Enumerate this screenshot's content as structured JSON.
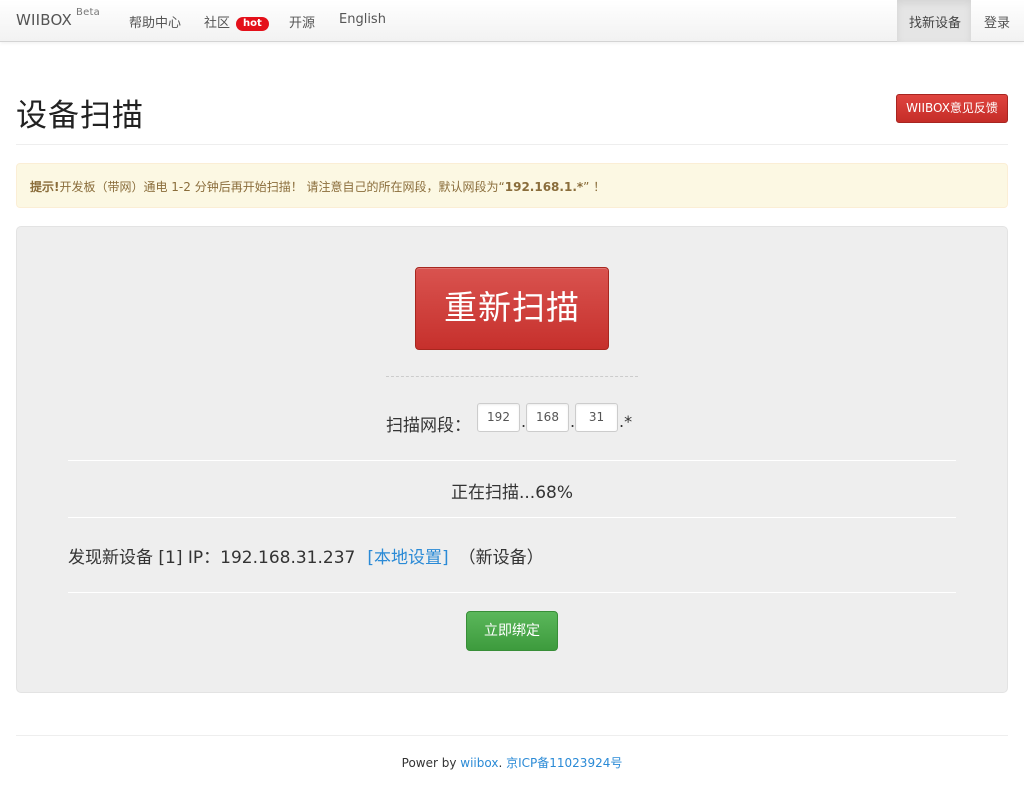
{
  "navbar": {
    "brand": "WIIBOX",
    "brand_sup": "Beta",
    "items": [
      {
        "label": "帮助中心"
      },
      {
        "label": "社区",
        "badge": "hot"
      },
      {
        "label": "开源"
      },
      {
        "label": "English"
      }
    ],
    "right": [
      {
        "label": "找新设备",
        "active": true
      },
      {
        "label": "登录"
      }
    ]
  },
  "page": {
    "title": "设备扫描",
    "feedback_button": "WIIBOX意见反馈"
  },
  "alert": {
    "strong": "提示!",
    "text_part1": "开发板（带网）通电 1-2 分钟后再开始扫描！ 请注意自己的所在网段，默认网段为“",
    "default_segment": "192.168.1.*",
    "text_part2": "” ！"
  },
  "scan": {
    "rescan_button": "重新扫描",
    "segment_label": "扫描网段：",
    "segment": [
      "192",
      "168",
      "31"
    ],
    "wildcard": ".*",
    "status": "正在扫描...68%",
    "found_text": "发现新设备 [1] IP：192.168.31.237",
    "local_settings_link": "[本地设置]",
    "new_device_tag": "（新设备）",
    "bind_button": "立即绑定"
  },
  "footer": {
    "prefix": "Power by ",
    "link1": "wiibox",
    "sep": ". ",
    "link2": "京ICP备11023924号"
  },
  "colors": {
    "danger": "#d9534f",
    "success": "#5bb75b",
    "link": "#2a8ad6",
    "alert_bg": "#fcf8e3",
    "badge_hot": "#e4101a"
  }
}
